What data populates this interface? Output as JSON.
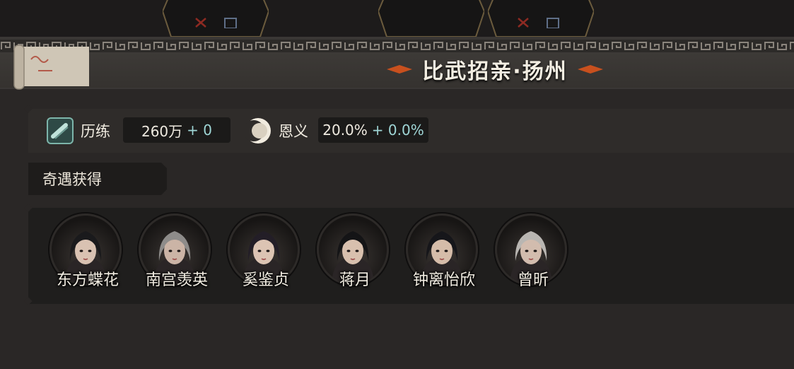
{
  "header": {
    "title": "比武招亲·扬州"
  },
  "top_tabs": [
    {
      "icon": "x-mark-icon"
    },
    {
      "icon": "x-mark-icon"
    }
  ],
  "stats": {
    "experience": {
      "label": "历练",
      "value": "260万",
      "bonus": "+ 0",
      "icon": "scroll-icon"
    },
    "favor": {
      "label": "恩义",
      "value": "20.0%",
      "bonus": "+ 0.0%",
      "icon": "moon-icon"
    }
  },
  "encounter": {
    "section_label": "奇遇获得",
    "characters": [
      {
        "name": "东方蝶花",
        "hair": "#1a1a1c",
        "skin": "#d9c2b2"
      },
      {
        "name": "南宫羡英",
        "hair": "#8e8c8a",
        "skin": "#cbb4a6"
      },
      {
        "name": "奚鉴贞",
        "hair": "#231e27",
        "skin": "#dcc4b3"
      },
      {
        "name": "蒋月",
        "hair": "#141416",
        "skin": "#d8c0ae"
      },
      {
        "name": "钟离怡欣",
        "hair": "#16161a",
        "skin": "#d5bca9"
      },
      {
        "name": "曾昕",
        "hair": "#b9b6b2",
        "skin": "#d2bcae"
      }
    ]
  },
  "colors": {
    "accent_orange": "#c8501e",
    "bonus_teal": "#9fd6d6",
    "panel_dark": "#1f1e1d"
  }
}
